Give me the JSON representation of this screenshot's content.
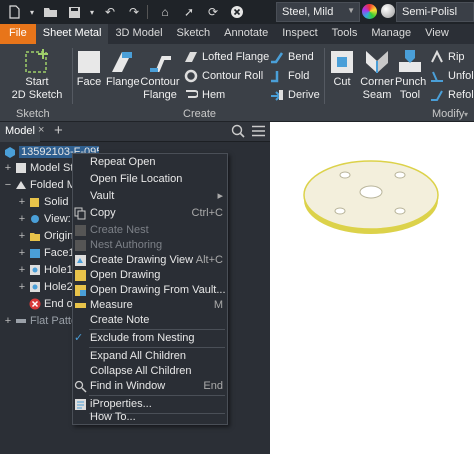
{
  "qat": {
    "material": "Steel, Mild",
    "appearance": "Semi-Polisl",
    "icons": [
      "new-icon",
      "open-icon",
      "save-icon",
      "undo-icon",
      "redo-icon",
      "home-icon",
      "select-icon",
      "close-icon"
    ]
  },
  "tabs": [
    {
      "label": "File"
    },
    {
      "label": "Sheet Metal"
    },
    {
      "label": "3D Model"
    },
    {
      "label": "Sketch"
    },
    {
      "label": "Annotate"
    },
    {
      "label": "Inspect"
    },
    {
      "label": "Tools"
    },
    {
      "label": "Manage"
    },
    {
      "label": "View"
    }
  ],
  "ribbon": {
    "sketch": {
      "start_label": "Start",
      "sketch_label": "2D Sketch",
      "group": "Sketch"
    },
    "create": {
      "face": "Face",
      "flange": "Flange",
      "contour1": "Contour",
      "contour2": "Flange",
      "lofted": "Lofted Flange",
      "roll": "Contour Roll",
      "hem": "Hem",
      "bend": "Bend",
      "fold": "Fold",
      "derive": "Derive",
      "group": "Create"
    },
    "modify": {
      "cut": "Cut",
      "corner1": "Corner",
      "corner2": "Seam",
      "punch1": "Punch",
      "punch2": "Tool",
      "rip": "Rip",
      "unfold": "Unfol",
      "refold": "Refol",
      "group": "Modify"
    }
  },
  "browser": {
    "tab": "Model",
    "close": "×",
    "add": "+",
    "root": "13592103-F-095.ipt",
    "nodes": [
      {
        "label": "Model Sta"
      },
      {
        "label": "Folded Mo"
      },
      {
        "label": "Solid B"
      },
      {
        "label": "View:"
      },
      {
        "label": "Origin"
      },
      {
        "label": "Face1"
      },
      {
        "label": "Hole1"
      },
      {
        "label": "Hole2"
      },
      {
        "label": "End of"
      },
      {
        "label": "Flat Patter"
      }
    ]
  },
  "context_menu": {
    "items": [
      {
        "label": "Repeat Open"
      },
      {
        "label": "Open File Location"
      },
      {
        "label": "Vault",
        "arrow": "▸"
      },
      {
        "label": "Copy",
        "shortcut": "Ctrl+C"
      },
      {
        "label": "Create Nest"
      },
      {
        "label": "Nest Authoring"
      },
      {
        "label": "Create Drawing View",
        "shortcut": "Alt+C"
      },
      {
        "label": "Open Drawing"
      },
      {
        "label": "Open Drawing From Vault..."
      },
      {
        "label": "Measure",
        "shortcut": "M"
      },
      {
        "label": "Create Note"
      },
      {
        "label": "Exclude from Nesting",
        "check": "✓"
      },
      {
        "label": "Expand All Children"
      },
      {
        "label": "Collapse All Children"
      },
      {
        "label": "Find in Window",
        "shortcut": "End"
      },
      {
        "label": "iProperties..."
      },
      {
        "label": "How To..."
      }
    ]
  },
  "colors": {
    "accent": "#e8751a",
    "part": "#f3efdc",
    "part_edge": "#dcd24a"
  }
}
